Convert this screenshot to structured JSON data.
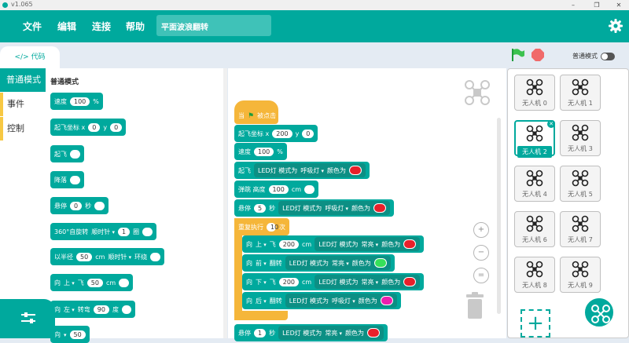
{
  "app": {
    "version": "v1.065"
  },
  "menu": {
    "file": "文件",
    "edit": "编辑",
    "connect": "连接",
    "help": "帮助",
    "project_name": "平面波浪翻转"
  },
  "tabs": {
    "code": "代码"
  },
  "mode_toggle": {
    "label": "普通模式"
  },
  "categories": [
    "普通模式",
    "事件",
    "控制"
  ],
  "palette": {
    "title": "普通模式",
    "speed": {
      "label": "速度",
      "value": "100",
      "unit": "%"
    },
    "takeoff_coord": {
      "label": "起飞坐标 x",
      "x": "0",
      "y_label": "y",
      "y": "0"
    },
    "takeoff": {
      "label": "起飞"
    },
    "land": {
      "label": "降落"
    },
    "hover": {
      "label": "悬停",
      "value": "0",
      "unit": "秒"
    },
    "rotate360": {
      "label": "360°自旋转",
      "dir": "顺时针",
      "value": "1",
      "unit": "圈"
    },
    "circle": {
      "prefix": "以半径",
      "value": "50",
      "unit": "cm",
      "dir": "顺时针",
      "suffix": "环绕"
    },
    "move": {
      "prefix": "向",
      "dir": "上",
      "mid": "飞",
      "value": "50",
      "unit": "cm"
    },
    "turn": {
      "prefix": "向",
      "dir": "左",
      "mid": "转弯",
      "value": "90",
      "unit": "度"
    },
    "bottom": {
      "prefix": "向",
      "dir": "",
      "value": "50"
    }
  },
  "script": {
    "hat": {
      "pre": "当",
      "post": "被点击"
    },
    "takeoff_coord": {
      "label": "起飞坐标 x",
      "x": "200",
      "y_label": "y",
      "y": "0"
    },
    "speed": {
      "label": "速度",
      "value": "100",
      "unit": "%"
    },
    "takeoff_led": {
      "pre": "起飞",
      "led": "LED灯 模式为",
      "mode": "呼吸灯",
      "color_label": "颜色为",
      "color": "#e8202a"
    },
    "bounce": {
      "pre": "弹跳 高度",
      "value": "100",
      "unit": "cm"
    },
    "hover_led": {
      "pre": "悬停",
      "value": "5",
      "unit": "秒",
      "led": "LED灯 模式为",
      "mode": "呼吸灯",
      "color_label": "颜色为",
      "color": "#e8202a"
    },
    "repeat": {
      "pre": "重复执行",
      "value": "10",
      "unit": "次"
    },
    "inner": [
      {
        "pre": "向",
        "dir": "上",
        "act": "飞",
        "value": "200",
        "unit": "cm",
        "led": "LED灯 模式为",
        "mode": "常亮",
        "color_label": "颜色为",
        "color": "#e8202a"
      },
      {
        "pre": "向",
        "dir": "前",
        "act": "翻转",
        "value": "",
        "unit": "",
        "led": "LED灯 模式为",
        "mode": "常亮",
        "color_label": "颜色为",
        "color": "#36e05a"
      },
      {
        "pre": "向",
        "dir": "下",
        "act": "飞",
        "value": "200",
        "unit": "cm",
        "led": "LED灯 模式为",
        "mode": "常亮",
        "color_label": "颜色为",
        "color": "#e8202a"
      },
      {
        "pre": "向",
        "dir": "后",
        "act": "翻转",
        "value": "",
        "unit": "",
        "led": "LED灯 模式为",
        "mode": "呼吸灯",
        "color_label": "颜色为",
        "color": "#ec1fae"
      }
    ],
    "last": {
      "pre": "悬停",
      "value": "1",
      "unit": "秒",
      "led": "LED灯 模式为",
      "mode": "常亮",
      "color_label": "颜色为",
      "color": "#e8202a"
    }
  },
  "drones": [
    "无人机 0",
    "无人机 1",
    "无人机 2",
    "无人机 3",
    "无人机 4",
    "无人机 5",
    "无人机 6",
    "无人机 7",
    "无人机 8",
    "无人机 9"
  ],
  "selected_drone": "无人机 2",
  "colors": {
    "accent": "#00a99d",
    "red": "#e8202a",
    "green": "#36e05a",
    "magenta": "#ec1fae",
    "hat": "#f5b63a"
  }
}
